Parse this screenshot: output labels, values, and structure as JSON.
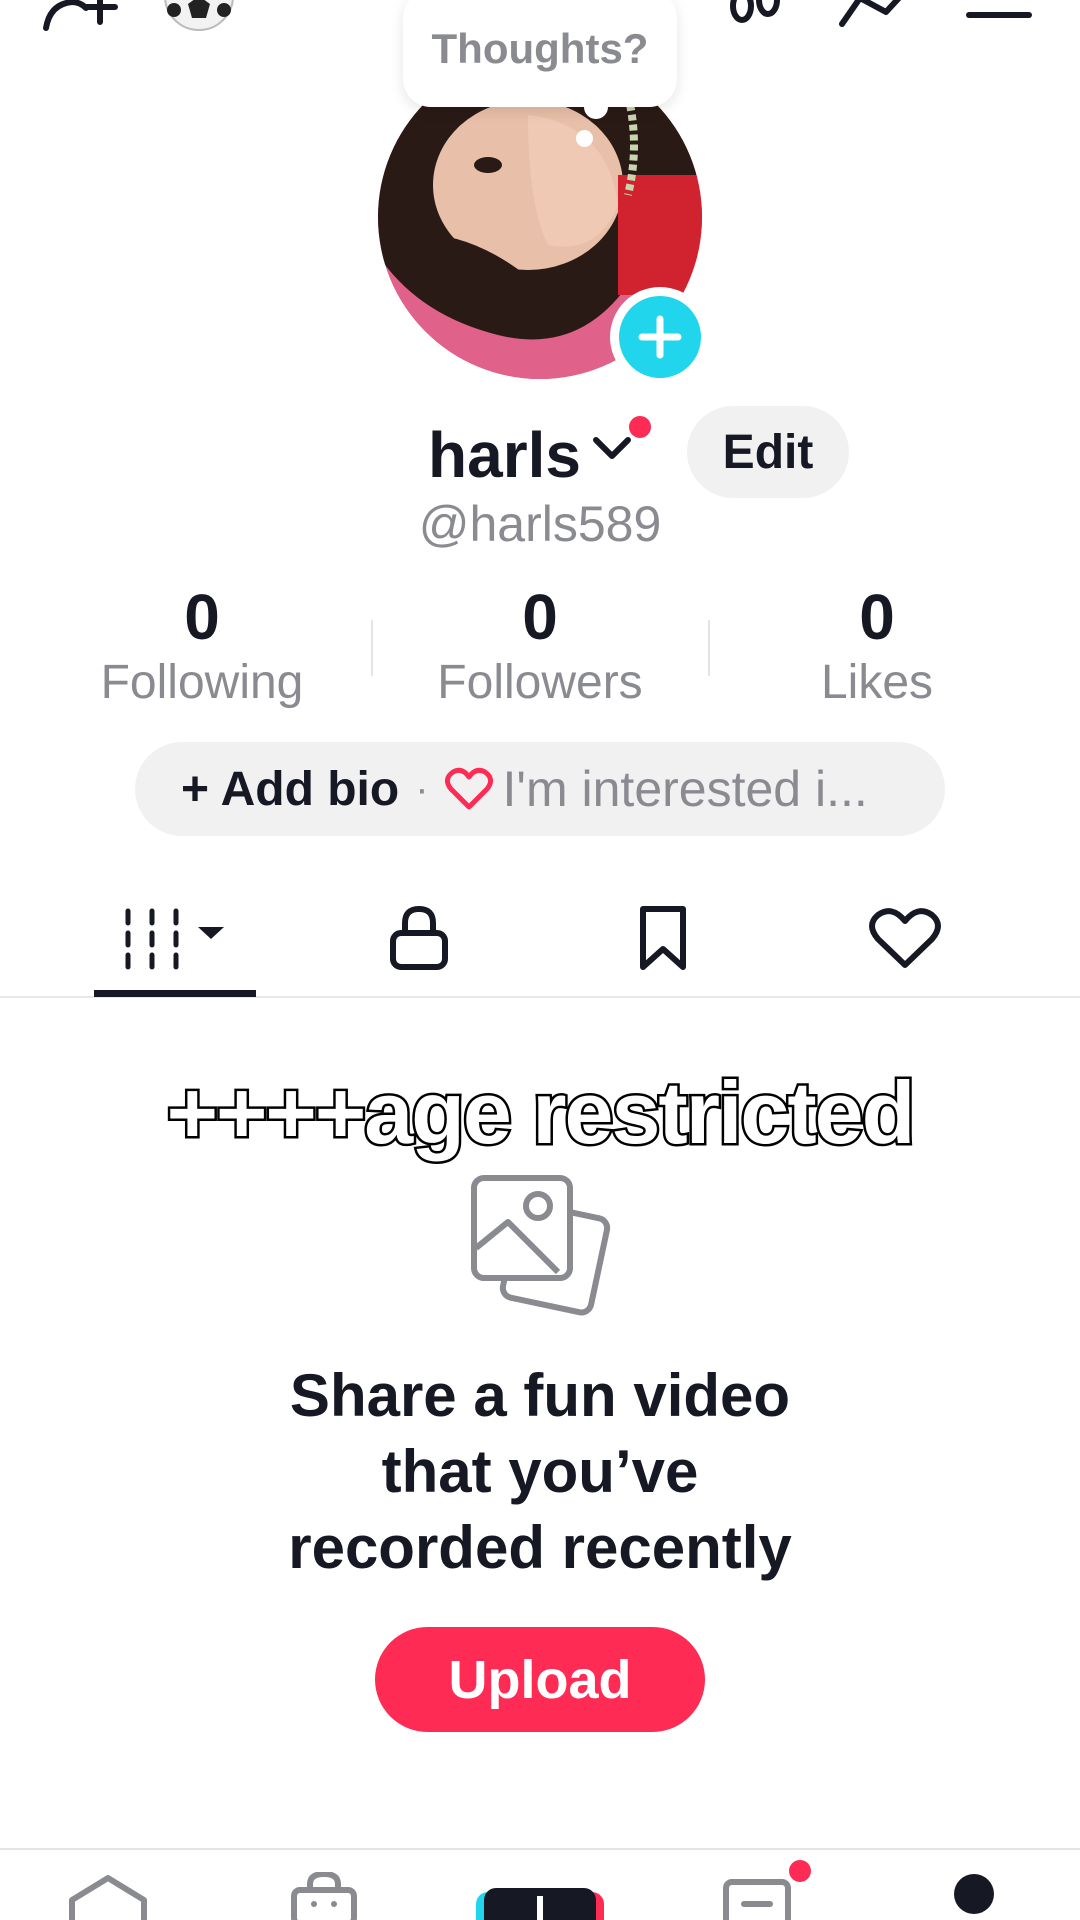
{
  "header": {
    "icons": [
      "add-friend-icon",
      "soccer-ball-icon",
      "footprints-icon",
      "share-icon",
      "menu-icon"
    ]
  },
  "thoughts_bubble": {
    "text": "Thoughts?"
  },
  "profile": {
    "display_name": "harls",
    "handle": "@harls589",
    "edit_label": "Edit"
  },
  "stats": [
    {
      "value": "0",
      "label": "Following"
    },
    {
      "value": "0",
      "label": "Followers"
    },
    {
      "value": "0",
      "label": "Likes"
    }
  ],
  "bio": {
    "add_label": "+ Add bio",
    "separator": "·",
    "interests": "I'm interested i..."
  },
  "tabs": [
    "videos-grid-icon",
    "private-lock-icon",
    "favorites-bookmark-icon",
    "liked-heart-icon"
  ],
  "content": {
    "overlay_text": "++++age restricted",
    "empty_title_lines": [
      "Share a fun video",
      "that you’ve",
      "recorded recently"
    ],
    "upload_label": "Upload"
  },
  "bottom_nav": [
    "home-icon",
    "shop-icon",
    "create-icon",
    "inbox-icon",
    "profile-icon"
  ],
  "colors": {
    "accent": "#fe2c55",
    "cyan": "#20d5ec",
    "text": "#161823",
    "muted": "#8a8b91"
  }
}
